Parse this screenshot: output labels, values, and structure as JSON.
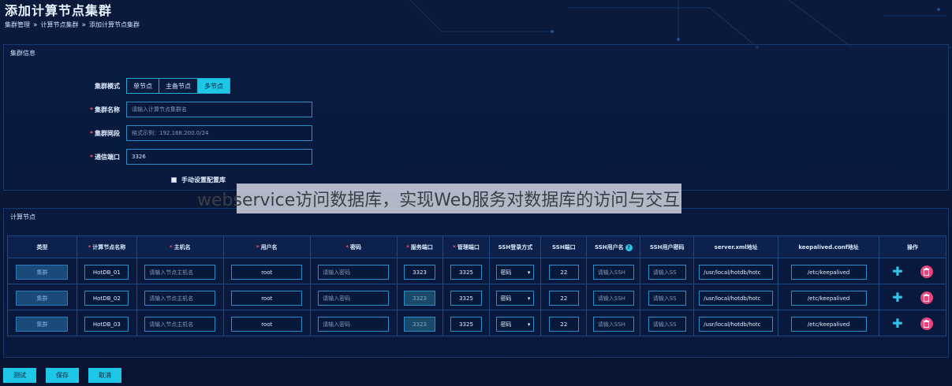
{
  "page": {
    "title": "添加计算节点集群"
  },
  "breadcrumb": [
    "集群管理",
    "计算节点集群",
    "添加计算节点集群"
  ],
  "cluster_panel": {
    "heading": "集群信息",
    "mode_label": "集群模式",
    "modes": [
      "单节点",
      "主备节点",
      "多节点"
    ],
    "active_mode": "多节点",
    "name_label": "集群名称",
    "name_placeholder": "请输入计算节点集群名",
    "network_label": "集群网段",
    "network_placeholder": "格式示例：192.168.200.0/24",
    "port_label": "通信端口",
    "port_value": "3326",
    "manual_db_label": "手动设置配置库"
  },
  "watermark": {
    "text": "webservice访问数据库，实现Web服务对数据库的访问与交互"
  },
  "nodes_panel": {
    "heading": "计算节点",
    "columns": [
      "类型",
      "计算节点名称",
      "主机名",
      "用户名",
      "密码",
      "服务端口",
      "管理端口",
      "SSH登录方式",
      "SSH端口",
      "SSH用户名",
      "SSH用户密码",
      "server.xml地址",
      "keepalived.conf地址",
      "操作"
    ],
    "rows": [
      {
        "type": "集群",
        "name": "HotDB_01",
        "host_ph": "请输入节点主机名",
        "user": "root",
        "pwd_ph": "请输入密码",
        "service_port": "3323",
        "manage_port": "3325",
        "ssh_login": "密码",
        "ssh_port": "22",
        "ssh_user_ph": "请输入SSH",
        "ssh_pwd_ph": "请输入SS",
        "server_xml": "/usr/local/hotdb/hotc",
        "keepalived": "/etc/keepalived"
      },
      {
        "type": "集群",
        "name": "HotDB_02",
        "host_ph": "请输入节点主机名",
        "user": "root",
        "pwd_ph": "请输入密码",
        "service_port": "3323",
        "manage_port": "3325",
        "ssh_login": "密码",
        "ssh_port": "22",
        "ssh_user_ph": "请输入SSH",
        "ssh_pwd_ph": "请输入SS",
        "server_xml": "/usr/local/hotdb/hotc",
        "keepalived": "/etc/keepalived"
      },
      {
        "type": "集群",
        "name": "HotDB_03",
        "host_ph": "请输入节点主机名",
        "user": "root",
        "pwd_ph": "请输入密码",
        "service_port": "3323",
        "manage_port": "3325",
        "ssh_login": "密码",
        "ssh_port": "22",
        "ssh_user_ph": "请输入SSH",
        "ssh_pwd_ph": "请输入SS",
        "server_xml": "/usr/local/hotdb/hotc",
        "keepalived": "/etc/keepalived"
      }
    ]
  },
  "footer_buttons": {
    "test": "测试",
    "save": "保存",
    "cancel": "取消"
  },
  "colors": {
    "accent": "#1fc7e6",
    "danger": "#e8457a",
    "required": "#ff4d5e"
  }
}
